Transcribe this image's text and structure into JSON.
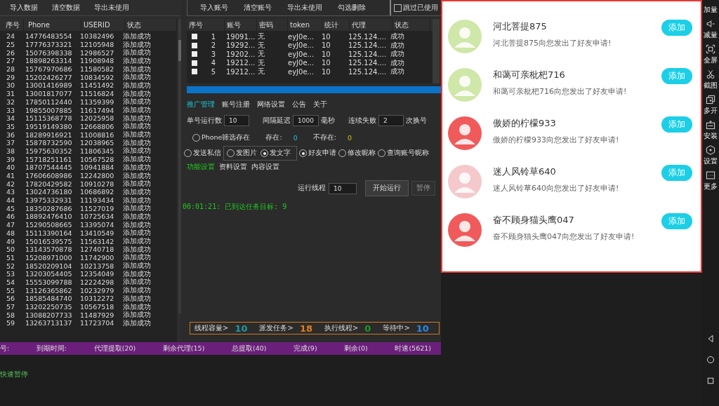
{
  "data_panel": {
    "buttons": [
      "导入数据",
      "清空数据",
      "导出未使用"
    ],
    "columns": [
      "序号",
      "Phone",
      "USERID",
      "状态"
    ],
    "rows": [
      [
        "24",
        "14776483554",
        "10382496",
        "添加成功"
      ],
      [
        "25",
        "17776373321",
        "12105948",
        "添加成功"
      ],
      [
        "26",
        "15076398338",
        "12986527",
        "添加成功"
      ],
      [
        "27",
        "18898263314",
        "11908948",
        "添加成功"
      ],
      [
        "28",
        "15767970686",
        "11580582",
        "添加成功"
      ],
      [
        "29",
        "15202426277",
        "10834592",
        "添加成功"
      ],
      [
        "30",
        "13001416989",
        "11451492",
        "添加成功"
      ],
      [
        "31",
        "13001817077",
        "11516824",
        "添加成功"
      ],
      [
        "32",
        "17850112440",
        "11359399",
        "添加成功"
      ],
      [
        "33",
        "19855007885",
        "11617494",
        "添加成功"
      ],
      [
        "34",
        "15115368778",
        "12025958",
        "添加成功"
      ],
      [
        "35",
        "19519149380",
        "12668806",
        "添加成功"
      ],
      [
        "36",
        "18289916921",
        "11008816",
        "添加成功"
      ],
      [
        "37",
        "15878732590",
        "12038965",
        "添加成功"
      ],
      [
        "38",
        "15975630352",
        "11806345",
        "添加成功"
      ],
      [
        "39",
        "15718251161",
        "10567528",
        "添加成功"
      ],
      [
        "40",
        "18707544445",
        "10941884",
        "添加成功"
      ],
      [
        "41",
        "17606608986",
        "12242800",
        "添加成功"
      ],
      [
        "42",
        "17820429582",
        "10910278",
        "添加成功"
      ],
      [
        "43",
        "13024736180",
        "10686892",
        "添加成功"
      ],
      [
        "44",
        "13975332931",
        "11193434",
        "添加成功"
      ],
      [
        "45",
        "18350287686",
        "11527019",
        "添加成功"
      ],
      [
        "46",
        "18892476410",
        "10725634",
        "添加成功"
      ],
      [
        "47",
        "15290508665",
        "13395074",
        "添加成功"
      ],
      [
        "48",
        "15113390164",
        "13410549",
        "添加成功"
      ],
      [
        "49",
        "15016539575",
        "11563142",
        "添加成功"
      ],
      [
        "50",
        "13143570878",
        "12740718",
        "添加成功"
      ],
      [
        "51",
        "15208971000",
        "11742900",
        "添加成功"
      ],
      [
        "52",
        "18520209104",
        "10213758",
        "添加成功"
      ],
      [
        "53",
        "13203054405",
        "12354049",
        "添加成功"
      ],
      [
        "54",
        "15553099788",
        "12224298",
        "添加成功"
      ],
      [
        "55",
        "13126365862",
        "10232979",
        "添加成功"
      ],
      [
        "56",
        "18585484740",
        "10312272",
        "添加成功"
      ],
      [
        "57",
        "13202250735",
        "10567518",
        "添加成功"
      ],
      [
        "58",
        "13088207733",
        "11487929",
        "添加成功"
      ],
      [
        "59",
        "13263713137",
        "11723704",
        "添加成功"
      ]
    ]
  },
  "account_panel": {
    "buttons": [
      "导入账号",
      "清空账号",
      "导出未使用",
      "勾选删除"
    ],
    "skip_used": {
      "label": "跳过已使用",
      "checked": false
    },
    "columns": [
      "序号",
      "账号",
      "密码",
      "token",
      "统计",
      "代理",
      "状态"
    ],
    "rows": [
      {
        "checked": false,
        "cells": [
          "1",
          "19091...",
          "无",
          "eyJ0e...",
          "10",
          "125.124....",
          "成功"
        ]
      },
      {
        "checked": false,
        "cells": [
          "2",
          "19292...",
          "无",
          "eyJ0e...",
          "10",
          "125.124....",
          "成功"
        ]
      },
      {
        "checked": false,
        "cells": [
          "3",
          "19202...",
          "无",
          "eyJ0e...",
          "10",
          "125.124....",
          "成功"
        ]
      },
      {
        "checked": false,
        "cells": [
          "4",
          "19212...",
          "无",
          "eyJ0e...",
          "10",
          "125.124....",
          "成功"
        ]
      },
      {
        "checked": false,
        "cells": [
          "5",
          "19212...",
          "无",
          "eyJ0e...",
          "10",
          "125.124....",
          "成功"
        ]
      }
    ],
    "progress": {
      "level": 1
    }
  },
  "tabs": [
    {
      "label": "推广管理",
      "selected": true
    },
    {
      "label": "账号注册",
      "selected": false
    },
    {
      "label": "网络设置",
      "selected": false
    },
    {
      "label": "公告",
      "selected": false
    },
    {
      "label": "关于",
      "selected": false
    }
  ],
  "settings": [
    {
      "label": "单号运行数",
      "value": "10"
    },
    {
      "label": "间隔延迟",
      "value": "1000",
      "unit": "毫秒"
    },
    {
      "label": "连续失败",
      "value": "2",
      "unit": "次换号"
    }
  ],
  "filter": {
    "label": "Phone筛选存在",
    "selected": false,
    "exists_label": "存在:",
    "exists_value": "0",
    "missing_label": "不存在:",
    "missing_value": "0"
  },
  "send_private": {
    "label": "发送私信",
    "selected": false
  },
  "content_type": [
    {
      "label": "发图片",
      "selected": false
    },
    {
      "label": "发文字",
      "selected": true
    }
  ],
  "actions": [
    {
      "label": "好友申请",
      "selected": true
    },
    {
      "label": "修改昵称",
      "selected": false
    },
    {
      "label": "查询账号昵称",
      "selected": false
    }
  ],
  "sub_tabs": [
    {
      "label": "功能设置",
      "selected": true
    },
    {
      "label": "资料设置",
      "selected": false
    },
    {
      "label": "内容设置",
      "selected": false
    }
  ],
  "run": {
    "threads_label": "运行线程",
    "threads": "10",
    "start": "开始运行",
    "pause": "暂停",
    "pause_disabled": true
  },
  "log": [
    "00:01:21: 已到达任务目标: 9"
  ],
  "thread_stats": [
    {
      "label": "线程容量>",
      "value": "10",
      "color": "#1f9aa0"
    },
    {
      "label": "派发任务>",
      "value": "18",
      "color": "#e0801a"
    },
    {
      "label": "执行线程>",
      "value": "0",
      "color": "#1e9a2a"
    },
    {
      "label": "等待中>",
      "value": "10",
      "color": "#2a8ae8"
    }
  ],
  "status_bar": [
    "号:",
    "到期时间:",
    "代理提取(20)",
    "剩余代理(15)",
    "总提取(40)",
    "完成(9)",
    "剩余(0)",
    "时速(5621)"
  ],
  "bottom_log": "快速暂停",
  "phone": {
    "requests": [
      {
        "name": "河北菩提875",
        "message": "河北菩提875向您发出了好友申请!",
        "button": "添加",
        "color": "#cfe7a8"
      },
      {
        "name": "和蔼可亲枇杷716",
        "message": "和蔼可亲枇杷716向您发出了好友申请!",
        "button": "添加",
        "color": "#cfe7a8"
      },
      {
        "name": "傲娇的柠檬933",
        "message": "傲娇的柠檬933向您发出了好友申请!",
        "button": "添加",
        "color": "#f05a5a"
      },
      {
        "name": "迷人风铃草640",
        "message": "迷人风铃草640向您发出了好友申请!",
        "button": "添加",
        "color": "#f5c8cc"
      },
      {
        "name": "奋不顾身猫头鹰047",
        "message": "奋不顾身猫头鹰047向您发出了好友申请!",
        "button": "添加",
        "color": "#f05a5a"
      }
    ]
  },
  "side_toolbar": [
    {
      "label": "加量"
    },
    {
      "label": "减量",
      "kind": "speaker"
    },
    {
      "label": "全屏",
      "kind": "fullscreen"
    },
    {
      "label": "截图",
      "kind": "scissors"
    },
    {
      "label": "多开",
      "kind": "windows"
    },
    {
      "label": "安装",
      "kind": "apk"
    },
    {
      "label": "设置",
      "kind": "hexagon"
    },
    {
      "label": "更多",
      "kind": "more"
    }
  ],
  "nav": [
    {
      "kind": "back"
    },
    {
      "kind": "home"
    },
    {
      "kind": "recents"
    }
  ]
}
